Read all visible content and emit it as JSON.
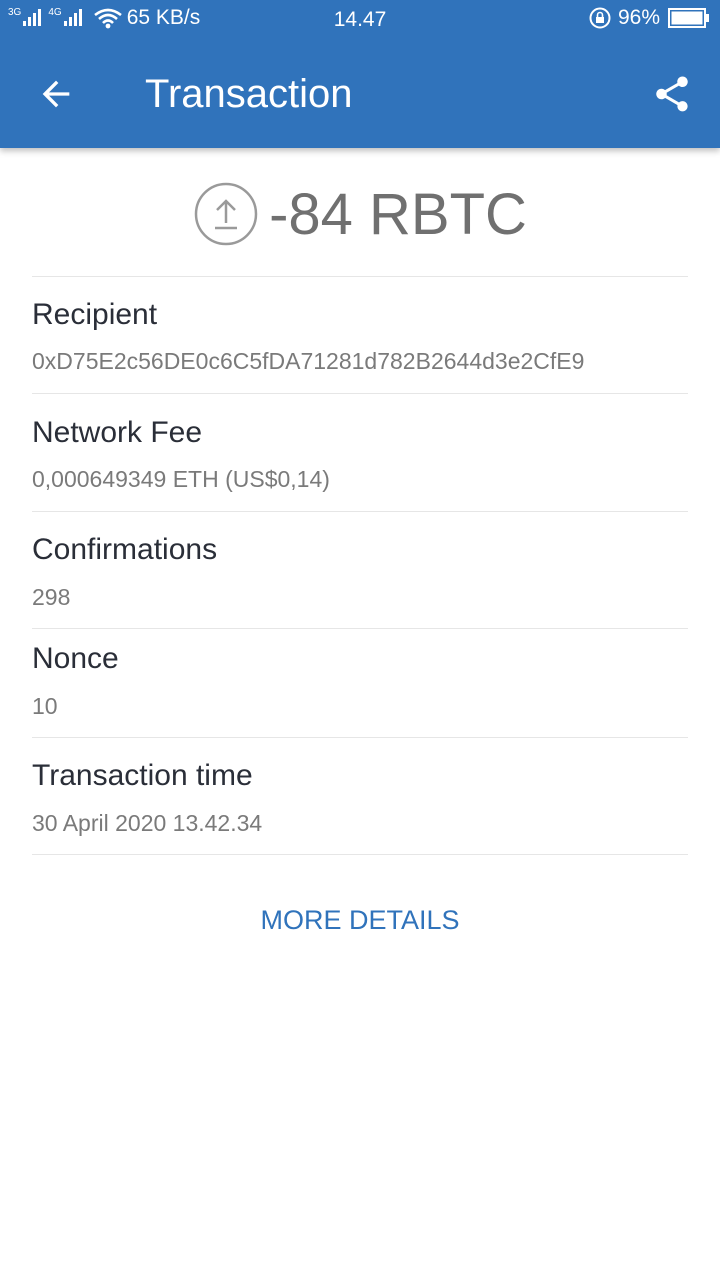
{
  "status_bar": {
    "network_1": "3G",
    "network_2": "4G",
    "speed": "65 KB/s",
    "time": "14.47",
    "battery": "96%"
  },
  "app_bar": {
    "title": "Transaction",
    "back_icon": "arrow-back-icon",
    "share_icon": "share-icon"
  },
  "amount": {
    "value": "-84 RBTC",
    "direction_icon": "upload-arrow-circle-icon"
  },
  "fields": [
    {
      "label": "Recipient",
      "value": "0xD75E2c56DE0c6C5fDA71281d782B2644d3e2CfE9"
    },
    {
      "label": "Network Fee",
      "value": "0,000649349 ETH (US$0,14)"
    },
    {
      "label": "Confirmations",
      "value": "298"
    },
    {
      "label": "Nonce",
      "value": "10"
    },
    {
      "label": "Transaction time",
      "value": "30 April 2020 13.42.34"
    }
  ],
  "more_details_label": "MORE DETAILS",
  "colors": {
    "primary": "#3073bb",
    "amount": "#707070",
    "label": "#2a2e38",
    "value": "#7a7a7a"
  }
}
